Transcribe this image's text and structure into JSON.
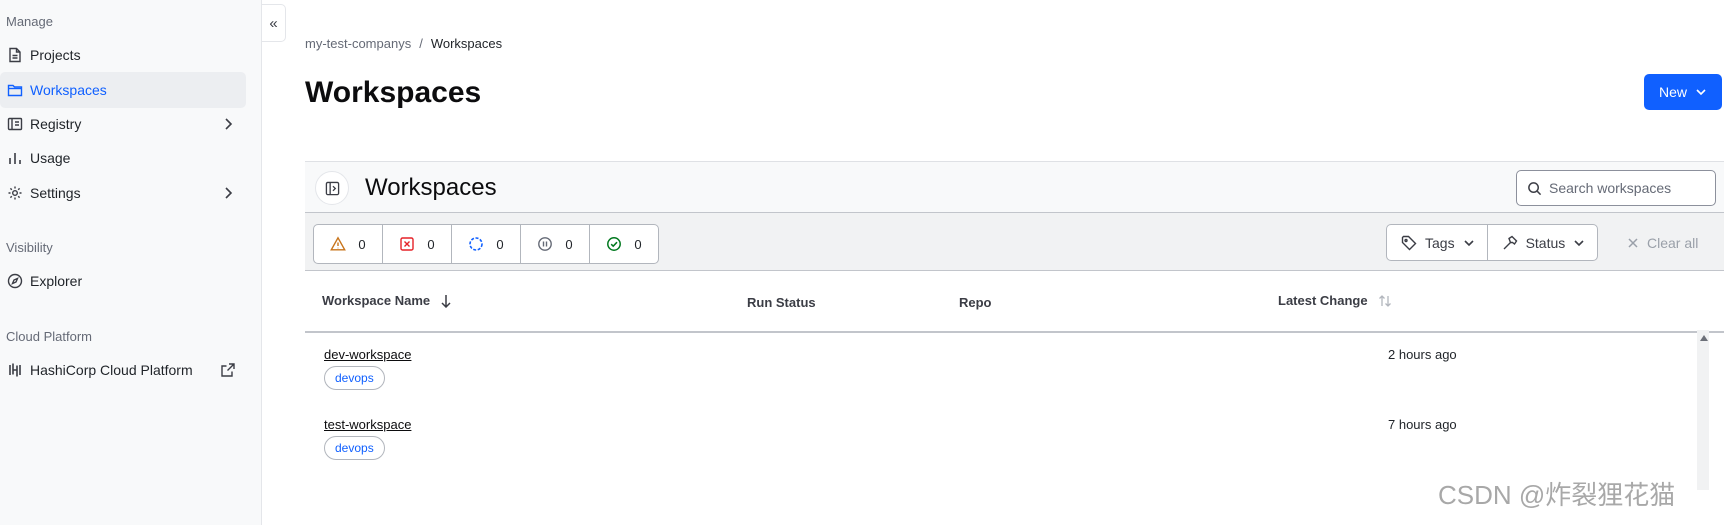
{
  "sidebar": {
    "manage_title": "Manage",
    "items": [
      {
        "label": "Projects",
        "icon": "document-icon"
      },
      {
        "label": "Workspaces",
        "icon": "folder-icon",
        "active": true
      },
      {
        "label": "Registry",
        "icon": "book-icon",
        "has_submenu": true
      },
      {
        "label": "Usage",
        "icon": "bar-chart-icon"
      },
      {
        "label": "Settings",
        "icon": "gear-icon",
        "has_submenu": true
      }
    ],
    "visibility_title": "Visibility",
    "visibility_items": [
      {
        "label": "Explorer",
        "icon": "compass-icon"
      }
    ],
    "cloud_title": "Cloud Platform",
    "cloud_items": [
      {
        "label": "HashiCorp Cloud Platform",
        "icon": "hashicorp-icon",
        "external": true
      }
    ],
    "collapse_glyph": "«"
  },
  "breadcrumb": {
    "org": "my-test-companys",
    "separator": "/",
    "current": "Workspaces"
  },
  "page": {
    "title": "Workspaces",
    "new_button": "New"
  },
  "panel": {
    "title": "Workspaces",
    "search_placeholder": "Search workspaces"
  },
  "status_filters": [
    {
      "icon": "warning-icon",
      "count": "0",
      "color": "#c8741b"
    },
    {
      "icon": "error-icon",
      "count": "0",
      "color": "#e52228"
    },
    {
      "icon": "running-icon",
      "count": "0",
      "color": "#1060ff"
    },
    {
      "icon": "paused-icon",
      "count": "0",
      "color": "#656a76"
    },
    {
      "icon": "success-icon",
      "count": "0",
      "color": "#00781e"
    }
  ],
  "filters": {
    "tags": "Tags",
    "status": "Status",
    "clear_all": "Clear all"
  },
  "table": {
    "columns": {
      "name": "Workspace Name",
      "run_status": "Run Status",
      "repo": "Repo",
      "latest_change": "Latest Change"
    },
    "rows": [
      {
        "name": "dev-workspace",
        "tag": "devops",
        "run_status": "",
        "repo": "",
        "latest_change": "2 hours ago"
      },
      {
        "name": "test-workspace",
        "tag": "devops",
        "run_status": "",
        "repo": "",
        "latest_change": "7 hours ago"
      }
    ]
  },
  "watermark": "CSDN @炸裂狸花猫",
  "colors": {
    "accent": "#1060ff",
    "sidebar_bg": "#f8f9fa"
  }
}
